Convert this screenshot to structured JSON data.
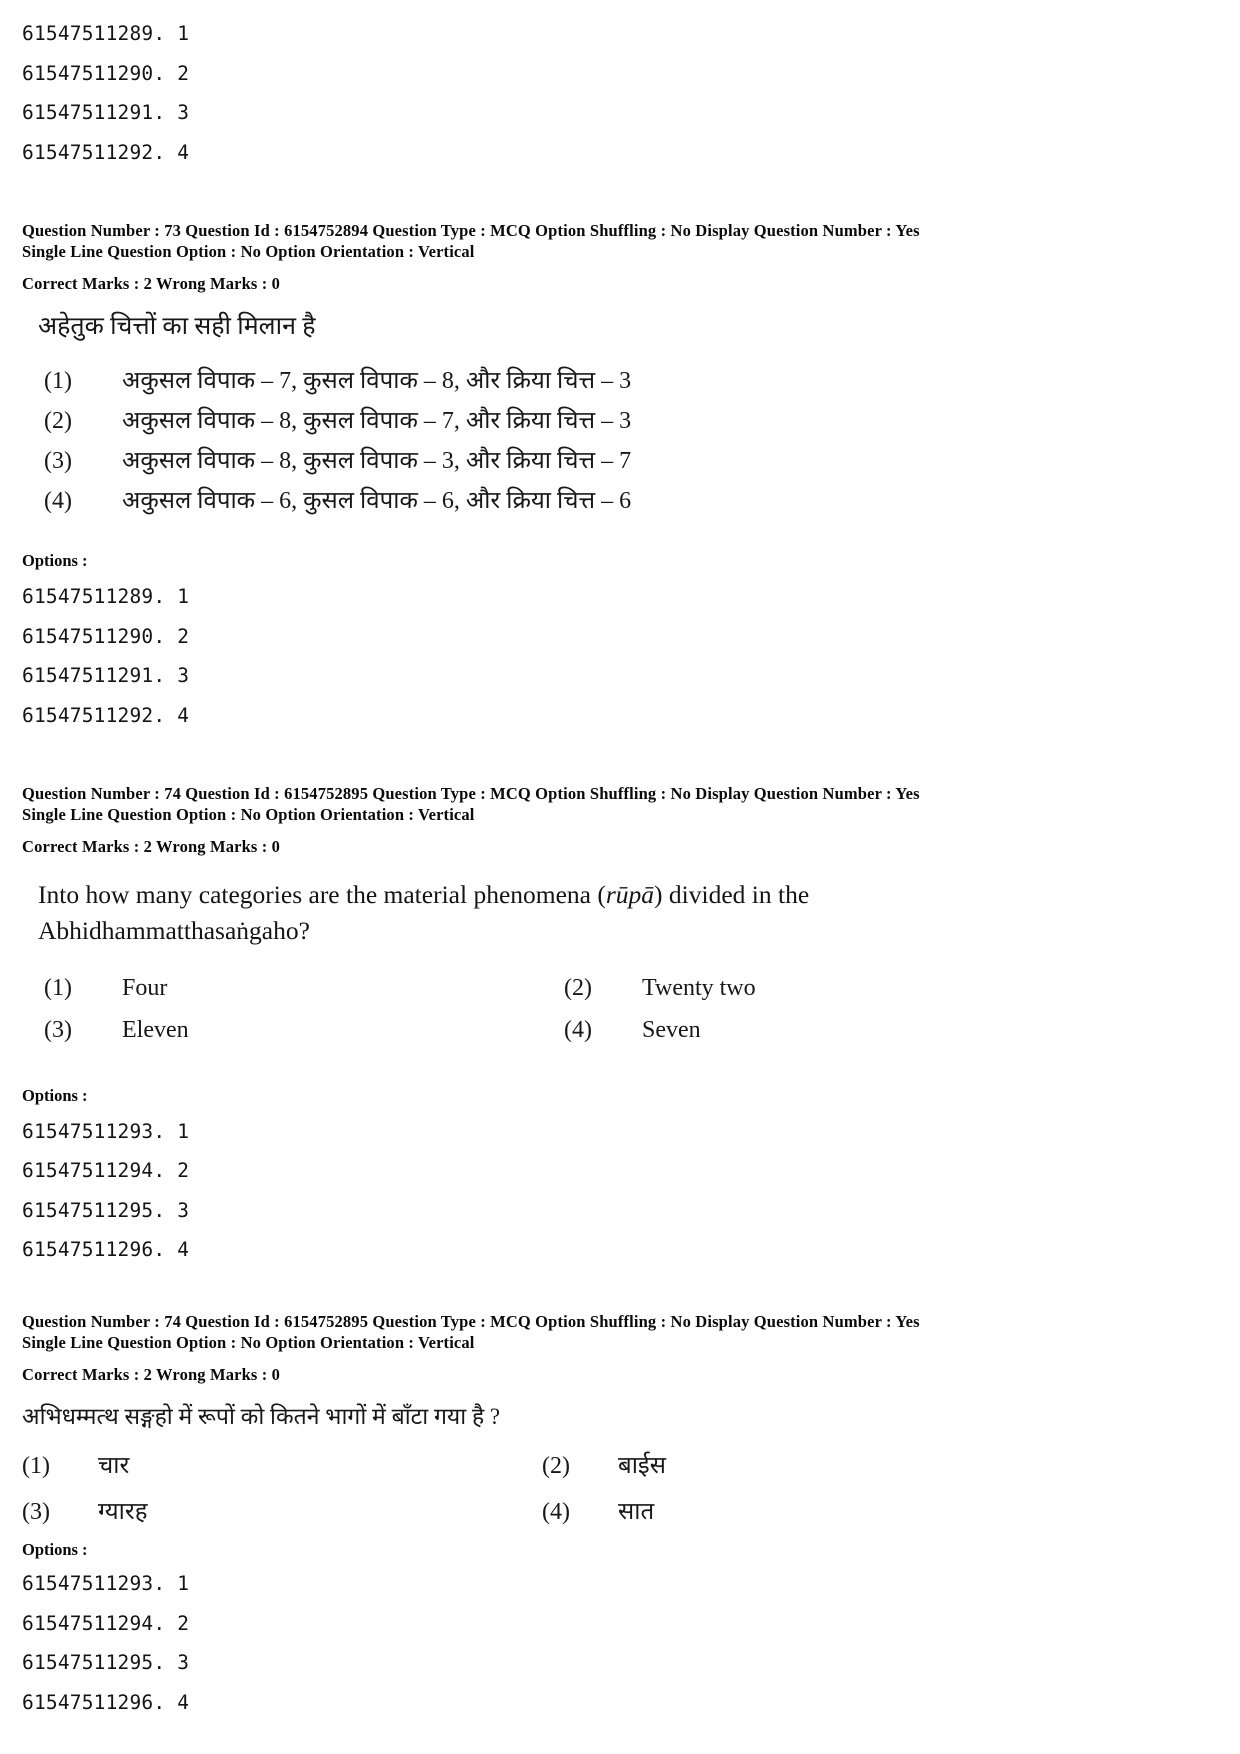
{
  "document": {
    "kind": "exam-answer-key-page"
  },
  "block_q72_tail": {
    "option_codes": [
      "61547511289. 1",
      "61547511290. 2",
      "61547511291. 3",
      "61547511292. 4"
    ]
  },
  "question_73": {
    "meta_line1": "Question Number : 73  Question Id : 6154752894  Question Type : MCQ  Option Shuffling : No  Display Question Number : Yes",
    "meta_line2": "Single Line Question Option : No  Option Orientation : Vertical",
    "marks_line": "Correct Marks : 2  Wrong Marks : 0",
    "question_text": "अहेतुक चित्तों का सही मिलान है",
    "options": [
      {
        "num": "(1)",
        "text": "अकुसल विपाक – 7, कुसल विपाक – 8, और क्रिया चित्त – 3"
      },
      {
        "num": "(2)",
        "text": "अकुसल विपाक – 8, कुसल विपाक – 7, और क्रिया चित्त – 3"
      },
      {
        "num": "(3)",
        "text": "अकुसल विपाक – 8, कुसल विपाक – 3, और क्रिया चित्त – 7"
      },
      {
        "num": "(4)",
        "text": "अकुसल विपाक – 6, कुसल विपाक – 6, और क्रिया चित्त – 6"
      }
    ],
    "options_label": "Options :",
    "option_codes": [
      "61547511289. 1",
      "61547511290. 2",
      "61547511291. 3",
      "61547511292. 4"
    ]
  },
  "question_74_en": {
    "meta_line1": "Question Number : 74  Question Id : 6154752895  Question Type : MCQ  Option Shuffling : No  Display Question Number : Yes",
    "meta_line2": "Single Line Question Option : No  Option Orientation : Vertical",
    "marks_line": "Correct Marks : 2  Wrong Marks : 0",
    "question_line1_pre": "Into  how  many  categories  are  the  material  phenomena  (",
    "question_line1_italic": "rūpā",
    "question_line1_post": ")  divided  in  the",
    "question_line2": "Abhidhammatthasaṅgaho?",
    "options": [
      {
        "num": "(1)",
        "text": "Four"
      },
      {
        "num": "(2)",
        "text": "Twenty two"
      },
      {
        "num": "(3)",
        "text": "Eleven"
      },
      {
        "num": "(4)",
        "text": "Seven"
      }
    ],
    "options_label": "Options :",
    "option_codes": [
      "61547511293. 1",
      "61547511294. 2",
      "61547511295. 3",
      "61547511296. 4"
    ]
  },
  "question_74_hi": {
    "meta_line1": "Question Number : 74  Question Id : 6154752895  Question Type : MCQ  Option Shuffling : No  Display Question Number : Yes",
    "meta_line2": "Single Line Question Option : No  Option Orientation : Vertical",
    "marks_line": "Correct Marks : 2  Wrong Marks : 0",
    "question_text": "अभिधम्मत्थ सङ्गहो में रूपों को कितने भागों में बाँटा गया है ?",
    "options": [
      {
        "num": "(1)",
        "text": "चार"
      },
      {
        "num": "(2)",
        "text": "बाईस"
      },
      {
        "num": "(3)",
        "text": "ग्यारह"
      },
      {
        "num": "(4)",
        "text": "सात"
      }
    ],
    "options_label": "Options :",
    "option_codes": [
      "61547511293. 1",
      "61547511294. 2",
      "61547511295. 3",
      "61547511296. 4"
    ]
  }
}
